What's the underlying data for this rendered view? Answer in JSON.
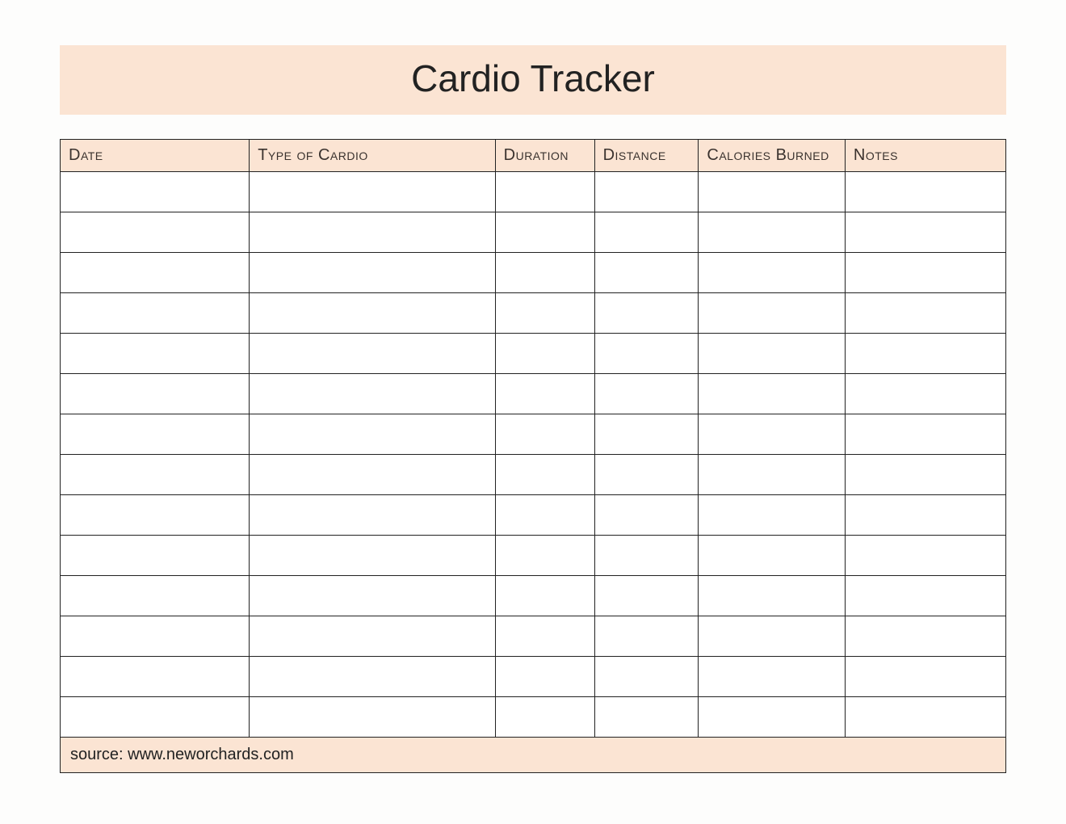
{
  "title": "Cardio Tracker",
  "columns": [
    {
      "key": "date",
      "label": "Date"
    },
    {
      "key": "type",
      "label": "Type of Cardio"
    },
    {
      "key": "duration",
      "label": "Duration"
    },
    {
      "key": "distance",
      "label": "Distance"
    },
    {
      "key": "calories",
      "label": "Calories Burned"
    },
    {
      "key": "notes",
      "label": "Notes"
    }
  ],
  "row_count": 14,
  "rows": [
    {
      "date": "",
      "type": "",
      "duration": "",
      "distance": "",
      "calories": "",
      "notes": ""
    },
    {
      "date": "",
      "type": "",
      "duration": "",
      "distance": "",
      "calories": "",
      "notes": ""
    },
    {
      "date": "",
      "type": "",
      "duration": "",
      "distance": "",
      "calories": "",
      "notes": ""
    },
    {
      "date": "",
      "type": "",
      "duration": "",
      "distance": "",
      "calories": "",
      "notes": ""
    },
    {
      "date": "",
      "type": "",
      "duration": "",
      "distance": "",
      "calories": "",
      "notes": ""
    },
    {
      "date": "",
      "type": "",
      "duration": "",
      "distance": "",
      "calories": "",
      "notes": ""
    },
    {
      "date": "",
      "type": "",
      "duration": "",
      "distance": "",
      "calories": "",
      "notes": ""
    },
    {
      "date": "",
      "type": "",
      "duration": "",
      "distance": "",
      "calories": "",
      "notes": ""
    },
    {
      "date": "",
      "type": "",
      "duration": "",
      "distance": "",
      "calories": "",
      "notes": ""
    },
    {
      "date": "",
      "type": "",
      "duration": "",
      "distance": "",
      "calories": "",
      "notes": ""
    },
    {
      "date": "",
      "type": "",
      "duration": "",
      "distance": "",
      "calories": "",
      "notes": ""
    },
    {
      "date": "",
      "type": "",
      "duration": "",
      "distance": "",
      "calories": "",
      "notes": ""
    },
    {
      "date": "",
      "type": "",
      "duration": "",
      "distance": "",
      "calories": "",
      "notes": ""
    },
    {
      "date": "",
      "type": "",
      "duration": "",
      "distance": "",
      "calories": "",
      "notes": ""
    }
  ],
  "source_line": "source: www.neworchards.com",
  "colors": {
    "peach": "#fbe4d3",
    "border": "#222222",
    "page_bg": "#fdfdfc"
  }
}
